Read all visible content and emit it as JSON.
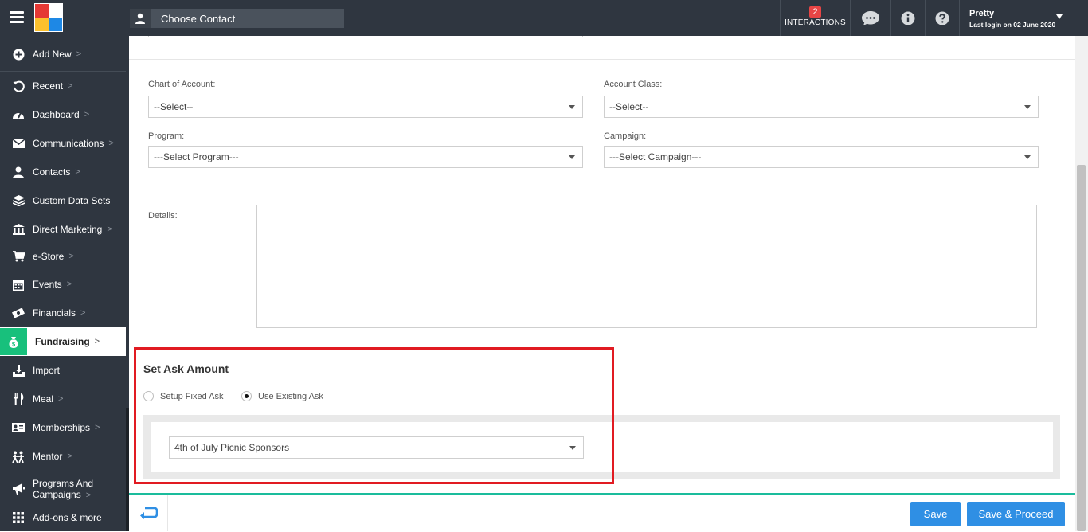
{
  "header": {
    "contact_placeholder": "Choose Contact",
    "interactions_count": "2",
    "interactions_label": "INTERACTIONS",
    "user_name": "Pretty",
    "last_login": "Last login on 02 June 2020",
    "logo_colors": [
      "#e53935",
      "#ffffff",
      "#fbc02d",
      "#1e88e5"
    ]
  },
  "sidebar": {
    "items": [
      {
        "label": "Add New",
        "icon": "plus-circle-icon"
      },
      {
        "label": "Recent",
        "icon": "history-icon"
      },
      {
        "label": "Dashboard",
        "icon": "dashboard-icon"
      },
      {
        "label": "Communications",
        "icon": "envelope-icon"
      },
      {
        "label": "Contacts",
        "icon": "user-icon"
      },
      {
        "label": "Custom Data Sets",
        "icon": "layers-icon"
      },
      {
        "label": "Direct Marketing",
        "icon": "bank-icon"
      },
      {
        "label": "e-Store",
        "icon": "cart-icon"
      },
      {
        "label": "Events",
        "icon": "calendar-icon"
      },
      {
        "label": "Financials",
        "icon": "money-icon"
      },
      {
        "label": "Fundraising",
        "icon": "money-bag-icon"
      },
      {
        "label": "Import",
        "icon": "import-icon"
      },
      {
        "label": "Meal",
        "icon": "cutlery-icon"
      },
      {
        "label": "Memberships",
        "icon": "id-card-icon"
      },
      {
        "label": "Mentor",
        "icon": "mentor-icon"
      },
      {
        "label": "Programs And",
        "label2": "Campaigns",
        "icon": "megaphone-icon"
      },
      {
        "label": "Add-ons & more",
        "icon": "grid-icon"
      }
    ]
  },
  "form": {
    "chart_of_account_label": "Chart of Account:",
    "chart_of_account_value": "--Select--",
    "account_class_label": "Account Class:",
    "account_class_value": "--Select--",
    "program_label": "Program:",
    "program_value": "---Select Program---",
    "campaign_label": "Campaign:",
    "campaign_value": "---Select Campaign---",
    "details_label": "Details:"
  },
  "ask": {
    "title": "Set Ask Amount",
    "option_fixed": "Setup Fixed Ask",
    "option_existing": "Use Existing Ask",
    "selected_ask": "4th of July Picnic Sponsors"
  },
  "footer": {
    "save_label": "Save",
    "save_proceed_label": "Save & Proceed"
  },
  "colors": {
    "sidebar_bg": "#2f3640",
    "active_accent": "#18c07c",
    "button_blue": "#2f8fe4",
    "highlight_red": "#e11b22",
    "footer_line": "#1abc9c"
  }
}
